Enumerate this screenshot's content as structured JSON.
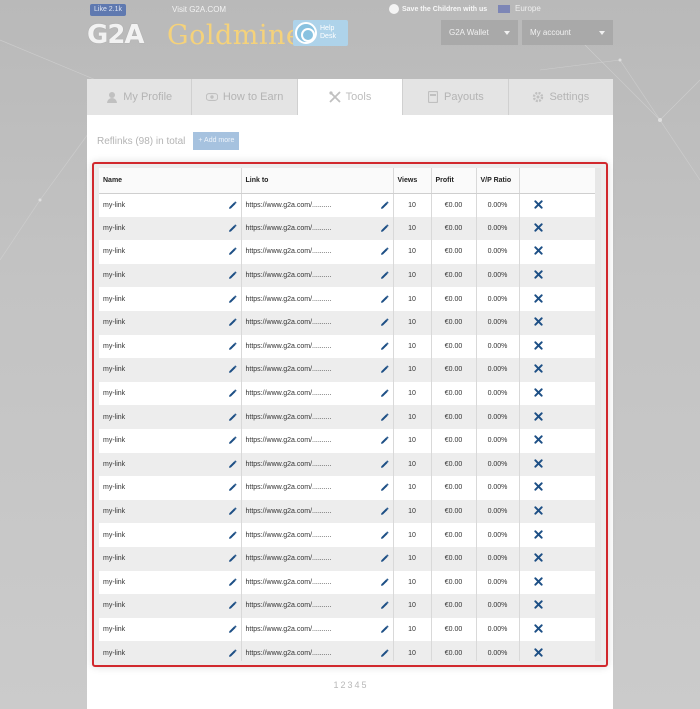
{
  "topbar": {
    "like_label": "Like 2.1k",
    "visit_label": "Visit G2A.COM",
    "charity_label": "Save the Children with us",
    "region_label": "Europe"
  },
  "header": {
    "logo_g2a": "G2A",
    "logo_goldmine": "Goldmine",
    "help_desk_label": "Help Desk",
    "wallet_label": "G2A Wallet",
    "account_label": "My account"
  },
  "tabs": [
    {
      "label": "My Profile",
      "icon": "user-icon",
      "active": false
    },
    {
      "label": "How to Earn",
      "icon": "money-icon",
      "active": false
    },
    {
      "label": "Tools",
      "icon": "tools-icon",
      "active": true
    },
    {
      "label": "Payouts",
      "icon": "wallet-icon",
      "active": false
    },
    {
      "label": "Settings",
      "icon": "gear-icon",
      "active": false
    }
  ],
  "reflinks": {
    "count_label": "Reflinks (98) in total",
    "add_more_label": "+ Add more"
  },
  "table": {
    "columns": [
      "Name",
      "Link to",
      "Views",
      "Profit",
      "V/P Ratio",
      ""
    ],
    "rows": [
      {
        "name": "my-link",
        "link": "https://www.g2a.com/..........",
        "views": "10",
        "profit": "€0.00",
        "ratio": "0.00%"
      },
      {
        "name": "my-link",
        "link": "https://www.g2a.com/..........",
        "views": "10",
        "profit": "€0.00",
        "ratio": "0.00%"
      },
      {
        "name": "my-link",
        "link": "https://www.g2a.com/..........",
        "views": "10",
        "profit": "€0.00",
        "ratio": "0.00%"
      },
      {
        "name": "my-link",
        "link": "https://www.g2a.com/..........",
        "views": "10",
        "profit": "€0.00",
        "ratio": "0.00%"
      },
      {
        "name": "my-link",
        "link": "https://www.g2a.com/..........",
        "views": "10",
        "profit": "€0.00",
        "ratio": "0.00%"
      },
      {
        "name": "my-link",
        "link": "https://www.g2a.com/..........",
        "views": "10",
        "profit": "€0.00",
        "ratio": "0.00%"
      },
      {
        "name": "my-link",
        "link": "https://www.g2a.com/..........",
        "views": "10",
        "profit": "€0.00",
        "ratio": "0.00%"
      },
      {
        "name": "my-link",
        "link": "https://www.g2a.com/..........",
        "views": "10",
        "profit": "€0.00",
        "ratio": "0.00%"
      },
      {
        "name": "my-link",
        "link": "https://www.g2a.com/..........",
        "views": "10",
        "profit": "€0.00",
        "ratio": "0.00%"
      },
      {
        "name": "my-link",
        "link": "https://www.g2a.com/..........",
        "views": "10",
        "profit": "€0.00",
        "ratio": "0.00%"
      },
      {
        "name": "my-link",
        "link": "https://www.g2a.com/..........",
        "views": "10",
        "profit": "€0.00",
        "ratio": "0.00%"
      },
      {
        "name": "my-link",
        "link": "https://www.g2a.com/..........",
        "views": "10",
        "profit": "€0.00",
        "ratio": "0.00%"
      },
      {
        "name": "my-link",
        "link": "https://www.g2a.com/..........",
        "views": "10",
        "profit": "€0.00",
        "ratio": "0.00%"
      },
      {
        "name": "my-link",
        "link": "https://www.g2a.com/..........",
        "views": "10",
        "profit": "€0.00",
        "ratio": "0.00%"
      },
      {
        "name": "my-link",
        "link": "https://www.g2a.com/..........",
        "views": "10",
        "profit": "€0.00",
        "ratio": "0.00%"
      },
      {
        "name": "my-link",
        "link": "https://www.g2a.com/..........",
        "views": "10",
        "profit": "€0.00",
        "ratio": "0.00%"
      },
      {
        "name": "my-link",
        "link": "https://www.g2a.com/..........",
        "views": "10",
        "profit": "€0.00",
        "ratio": "0.00%"
      },
      {
        "name": "my-link",
        "link": "https://www.g2a.com/..........",
        "views": "10",
        "profit": "€0.00",
        "ratio": "0.00%"
      },
      {
        "name": "my-link",
        "link": "https://www.g2a.com/..........",
        "views": "10",
        "profit": "€0.00",
        "ratio": "0.00%"
      },
      {
        "name": "my-link",
        "link": "https://www.g2a.com/..........",
        "views": "10",
        "profit": "€0.00",
        "ratio": "0.00%"
      }
    ]
  },
  "pagination": [
    "1",
    "2",
    "3",
    "4",
    "5"
  ],
  "colors": {
    "highlight_border": "#d1282d",
    "icon_blue": "#1d4f85",
    "gold": "#f5d27a"
  }
}
